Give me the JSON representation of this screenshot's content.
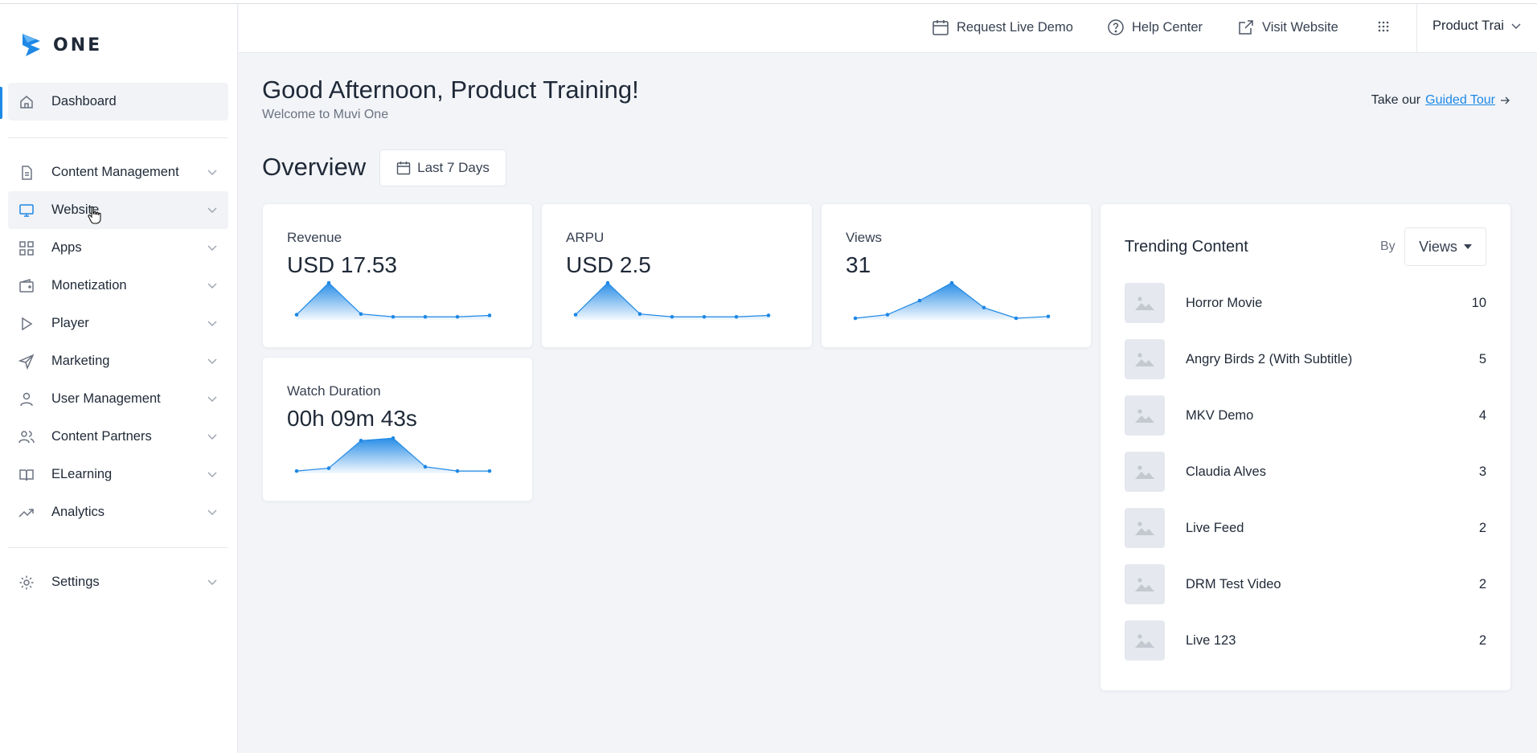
{
  "brand": {
    "logo_text": "ONE",
    "accent": "#1e88e5"
  },
  "topbar": {
    "request_demo": "Request Live Demo",
    "help_center": "Help Center",
    "visit_website": "Visit Website",
    "user_menu": "Product Trai"
  },
  "sidebar": {
    "dashboard": "Dashboard",
    "items": [
      {
        "label": "Content Management",
        "icon": "document-icon"
      },
      {
        "label": "Website",
        "icon": "monitor-icon"
      },
      {
        "label": "Apps",
        "icon": "grid-icon"
      },
      {
        "label": "Monetization",
        "icon": "wallet-icon"
      },
      {
        "label": "Player",
        "icon": "play-icon"
      },
      {
        "label": "Marketing",
        "icon": "send-icon"
      },
      {
        "label": "User Management",
        "icon": "user-icon"
      },
      {
        "label": "Content Partners",
        "icon": "users-icon"
      },
      {
        "label": "ELearning",
        "icon": "book-icon"
      },
      {
        "label": "Analytics",
        "icon": "trending-up-icon"
      }
    ],
    "settings": "Settings"
  },
  "main": {
    "greeting": "Good Afternoon, Product Training!",
    "welcome": "Welcome to Muvi One",
    "tour_prefix": "Take our",
    "tour_link": "Guided Tour",
    "overview_title": "Overview",
    "date_range": "Last 7 Days"
  },
  "cards": {
    "revenue": {
      "label": "Revenue",
      "value": "USD 17.53",
      "series": [
        0.1,
        1.0,
        0.12,
        0.04,
        0.04,
        0.04,
        0.08
      ]
    },
    "arpu": {
      "label": "ARPU",
      "value": "USD 2.5",
      "series": [
        0.1,
        1.0,
        0.12,
        0.04,
        0.04,
        0.04,
        0.08
      ]
    },
    "views": {
      "label": "Views",
      "value": "31",
      "series": [
        0.0,
        0.1,
        0.5,
        1.0,
        0.3,
        0.0,
        0.05
      ]
    },
    "watch_duration": {
      "label": "Watch Duration",
      "value": "00h 09m 43s",
      "series": [
        0.02,
        0.1,
        0.88,
        0.95,
        0.14,
        0.02,
        0.02
      ]
    }
  },
  "trending": {
    "title": "Trending Content",
    "by_label": "By",
    "metric": "Views",
    "items": [
      {
        "name": "Horror Movie",
        "count": "10"
      },
      {
        "name": "Angry Birds 2 (With Subtitle)",
        "count": "5"
      },
      {
        "name": "MKV Demo",
        "count": "4"
      },
      {
        "name": "Claudia Alves",
        "count": "3"
      },
      {
        "name": "Live Feed",
        "count": "2"
      },
      {
        "name": "DRM Test Video",
        "count": "2"
      },
      {
        "name": "Live 123",
        "count": "2"
      }
    ]
  }
}
